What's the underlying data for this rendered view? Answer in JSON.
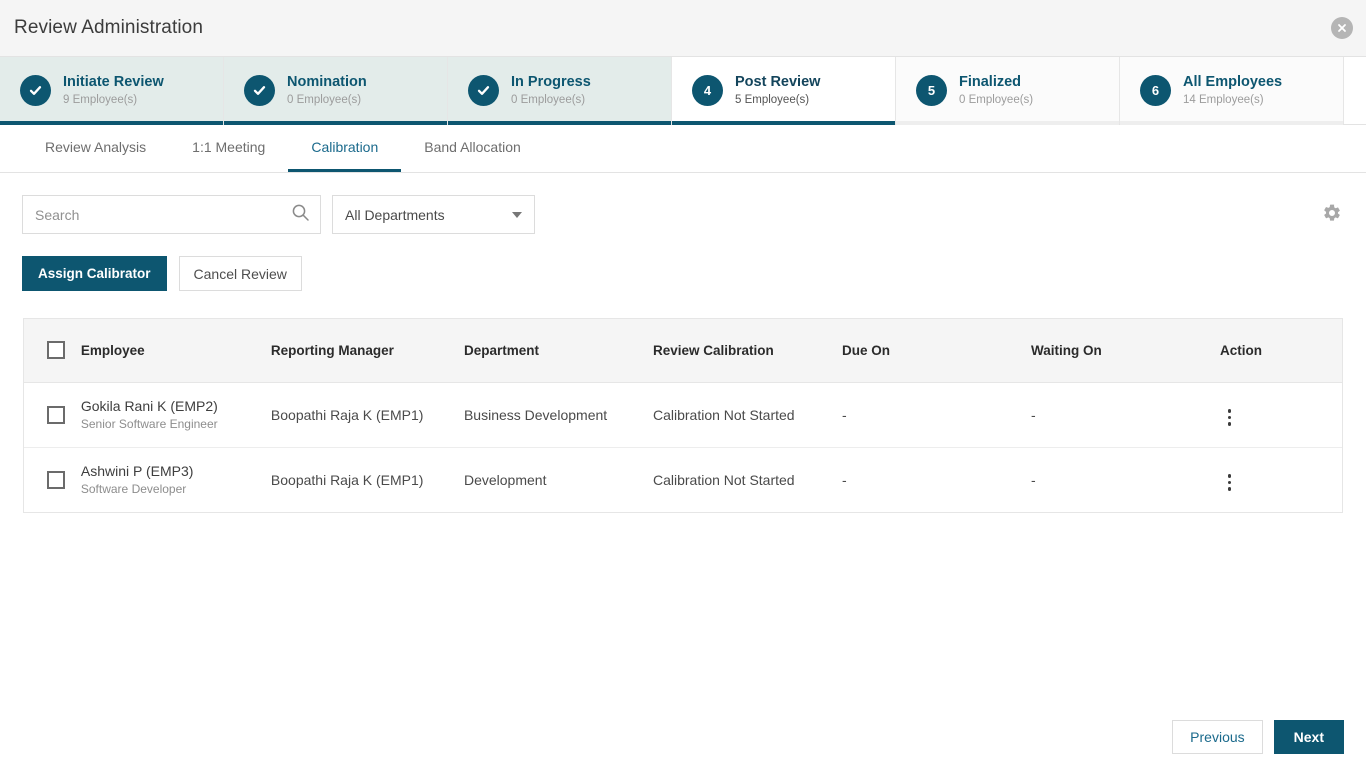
{
  "window": {
    "title": "Review Administration",
    "close_icon": "close-icon"
  },
  "stepper": {
    "steps": [
      {
        "number": "1",
        "label": "Initiate Review",
        "count": "9 Employee(s)",
        "state": "done"
      },
      {
        "number": "2",
        "label": "Nomination",
        "count": "0 Employee(s)",
        "state": "done"
      },
      {
        "number": "3",
        "label": "In Progress",
        "count": "0 Employee(s)",
        "state": "done"
      },
      {
        "number": "4",
        "label": "Post Review",
        "count": "5 Employee(s)",
        "state": "active"
      },
      {
        "number": "5",
        "label": "Finalized",
        "count": "0 Employee(s)",
        "state": "inactive"
      },
      {
        "number": "6",
        "label": "All Employees",
        "count": "14 Employee(s)",
        "state": "inactive"
      }
    ]
  },
  "tabs": [
    {
      "label": "Review Analysis",
      "active": false
    },
    {
      "label": "1:1 Meeting",
      "active": false
    },
    {
      "label": "Calibration",
      "active": true
    },
    {
      "label": "Band Allocation",
      "active": false
    }
  ],
  "filters": {
    "search_placeholder": "Search",
    "search_value": "",
    "search_icon": "search-icon",
    "department_selected": "All Departments",
    "settings_icon": "gear-icon"
  },
  "actions": {
    "assign_calibrator": "Assign Calibrator",
    "cancel_review": "Cancel Review"
  },
  "table": {
    "headers": [
      "Employee",
      "Reporting Manager",
      "Department",
      "Review Calibration",
      "Due On",
      "Waiting On",
      "Action"
    ],
    "rows": [
      {
        "employee_name": "Gokila Rani K (EMP2)",
        "employee_role": "Senior Software Engineer",
        "manager": "Boopathi Raja K (EMP1)",
        "department": "Business Development",
        "calibration": "Calibration Not Started",
        "due_on": "-",
        "waiting_on": "-",
        "action_icon": "kebab-menu-icon"
      },
      {
        "employee_name": "Ashwini P (EMP3)",
        "employee_role": "Software Developer",
        "manager": "Boopathi Raja K (EMP1)",
        "department": "Development",
        "calibration": "Calibration Not Started",
        "due_on": "-",
        "waiting_on": "-",
        "action_icon": "kebab-menu-icon"
      }
    ]
  },
  "footer": {
    "previous": "Previous",
    "next": "Next"
  },
  "colors": {
    "primary": "#0d5670",
    "step_done_bg": "#e3ecea",
    "header_bg": "#f5f5f5",
    "tab_active": "#1b6a8c",
    "muted_text": "#9c9c9c"
  }
}
